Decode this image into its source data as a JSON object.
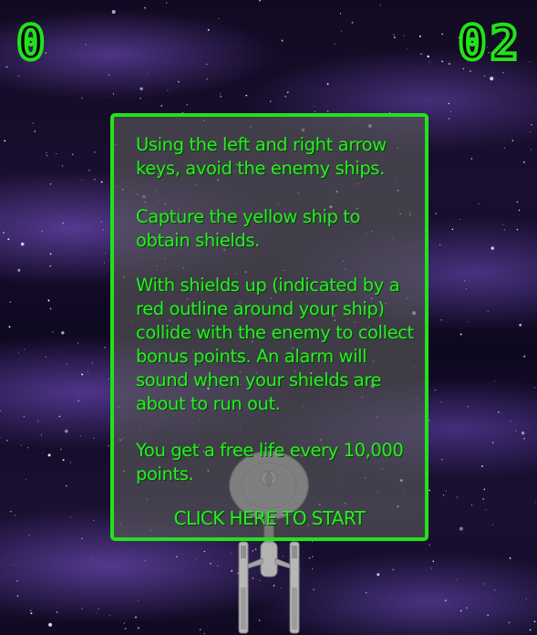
{
  "hud": {
    "score_left": "0",
    "score_right": "02"
  },
  "instructions": {
    "paragraphs": [
      "Using the left and right arrow keys, avoid the enemy ships.",
      "Capture the yellow ship to obtain shields.",
      "With shields up (indicated by a red outline around your ship) collide with the enemy to collect bonus points. An alarm will sound when your shields are about to run out.",
      "You get a free life every 10,000 points."
    ],
    "start_label": "CLICK HERE TO START"
  },
  "player_ship": {
    "icon": "starship-icon"
  },
  "colors": {
    "accent_green": "#22e21c",
    "panel_background": "#5c5c5c"
  }
}
